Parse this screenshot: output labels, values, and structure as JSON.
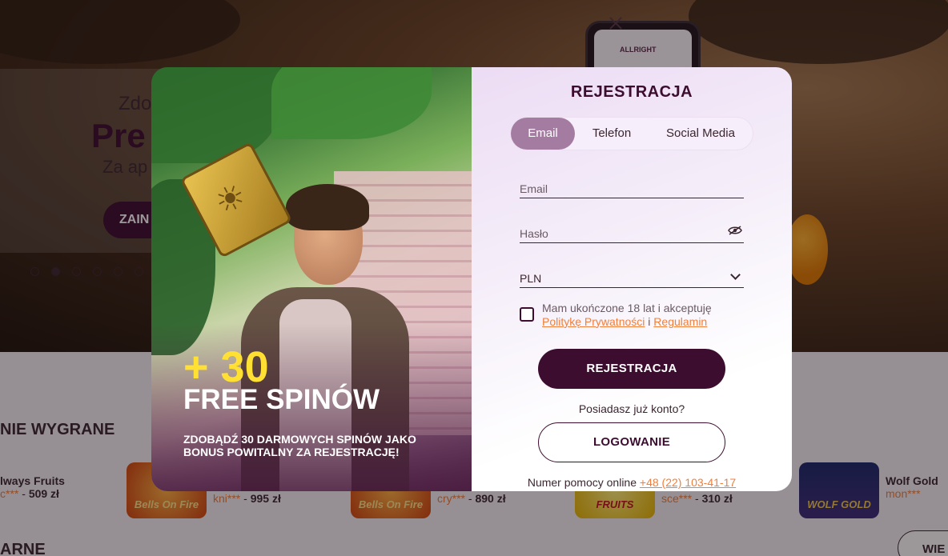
{
  "background": {
    "phone_brand": "ALLRIGHT",
    "banner": {
      "line1": "Zdo",
      "line2": "Pre",
      "line3": "Za ap",
      "button": "ZAIN"
    },
    "section_title": "NIE WYGRANE",
    "section_title_2": "ARNE",
    "wins": [
      {
        "game": "lways Fruits",
        "user": "c***",
        "amount": "509 zł"
      },
      {
        "thumb_label": "Bells On Fire",
        "user": "kni***",
        "amount": "995 zł"
      },
      {
        "thumb_label": "Bells On Fire",
        "user": "cry***",
        "amount": "890 zł"
      },
      {
        "thumb_label": "FRUITS",
        "user": "sce***",
        "amount": "310 zł"
      },
      {
        "thumb_label": "WOLF GOLD",
        "game": "Wolf Gold",
        "user": "mon***",
        "amount": ""
      }
    ],
    "more_button": "WIE"
  },
  "modal": {
    "promo": {
      "bonus_amount": "+ 30",
      "bonus_unit": "FREE SPINÓW",
      "description": "ZDOBĄDŹ 30 DARMOWYCH SPINÓW JAKO BONUS POWITALNY ZA REJESTRACJĘ!"
    },
    "title": "REJESTRACJA",
    "tabs": [
      {
        "label": "Email",
        "active": true
      },
      {
        "label": "Telefon",
        "active": false
      },
      {
        "label": "Social Media",
        "active": false
      }
    ],
    "fields": {
      "email_placeholder": "Email",
      "password_placeholder": "Hasło",
      "currency_value": "PLN"
    },
    "consent": {
      "text": "Mam ukończone 18 lat i akceptuję",
      "privacy_link": "Politykę Prywatności",
      "separator": "i",
      "terms_link": "Regulamin",
      "checked": false
    },
    "register_button": "REJESTRACJA",
    "have_account_text": "Posiadasz już konto?",
    "login_button": "LOGOWANIE",
    "helpline_label": "Numer pomocy online",
    "helpline_number": "+48 (22) 103-41-17"
  },
  "colors": {
    "brand_dark": "#3d0d30",
    "accent_orange": "#f07f3c",
    "tab_active": "#a47ca2",
    "promo_yellow": "#ffe033"
  }
}
